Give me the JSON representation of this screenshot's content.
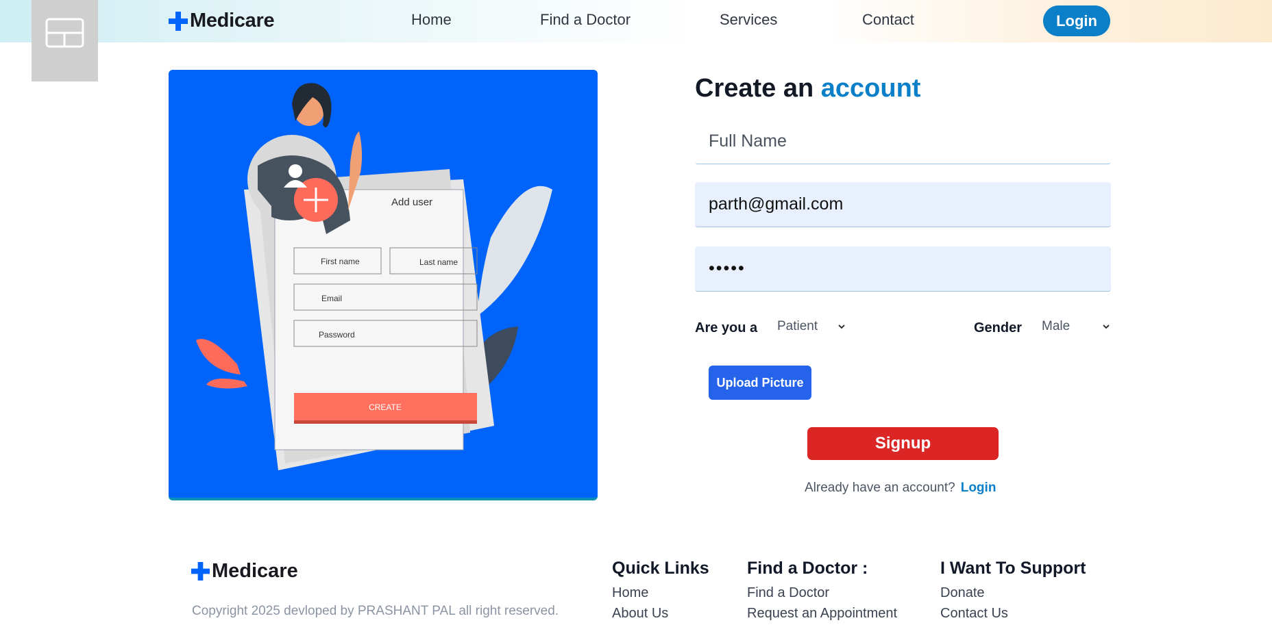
{
  "brand": {
    "name": "Medicare",
    "accent_color": "#0b7fc7"
  },
  "nav": {
    "items": [
      "Home",
      "Find a Doctor",
      "Services",
      "Contact"
    ],
    "login_label": "Login"
  },
  "illustration": {
    "add_user_label": "Add user",
    "first_name": "First name",
    "last_name": "Last name",
    "email": "Email",
    "password": "Password",
    "create_label": "CREATE"
  },
  "form": {
    "title_prefix": "Create an",
    "title_accent": "account",
    "full_name_placeholder": "Full Name",
    "email_value": "parth@gmail.com",
    "password_value": "•••••",
    "role_label": "Are you a",
    "role_selected": "Patient",
    "gender_label": "Gender",
    "gender_selected": "Male",
    "upload_label": "Upload Picture",
    "signup_label": "Signup",
    "already_text": "Already have an account?",
    "login_link": "Login"
  },
  "footer": {
    "brand": "Medicare",
    "copyright": "Copyright 2025 devloped by PRASHANT PAL all right reserved.",
    "columns": [
      {
        "title": "Quick Links",
        "links": [
          "Home",
          "About Us"
        ]
      },
      {
        "title": "Find a Doctor :",
        "links": [
          "Find a Doctor",
          "Request an Appointment"
        ]
      },
      {
        "title": "I Want To Support",
        "links": [
          "Donate",
          "Contact Us"
        ]
      }
    ]
  },
  "colors": {
    "primary_blue": "#0064fb",
    "danger": "#dc2626",
    "button_blue": "#2563eb"
  }
}
